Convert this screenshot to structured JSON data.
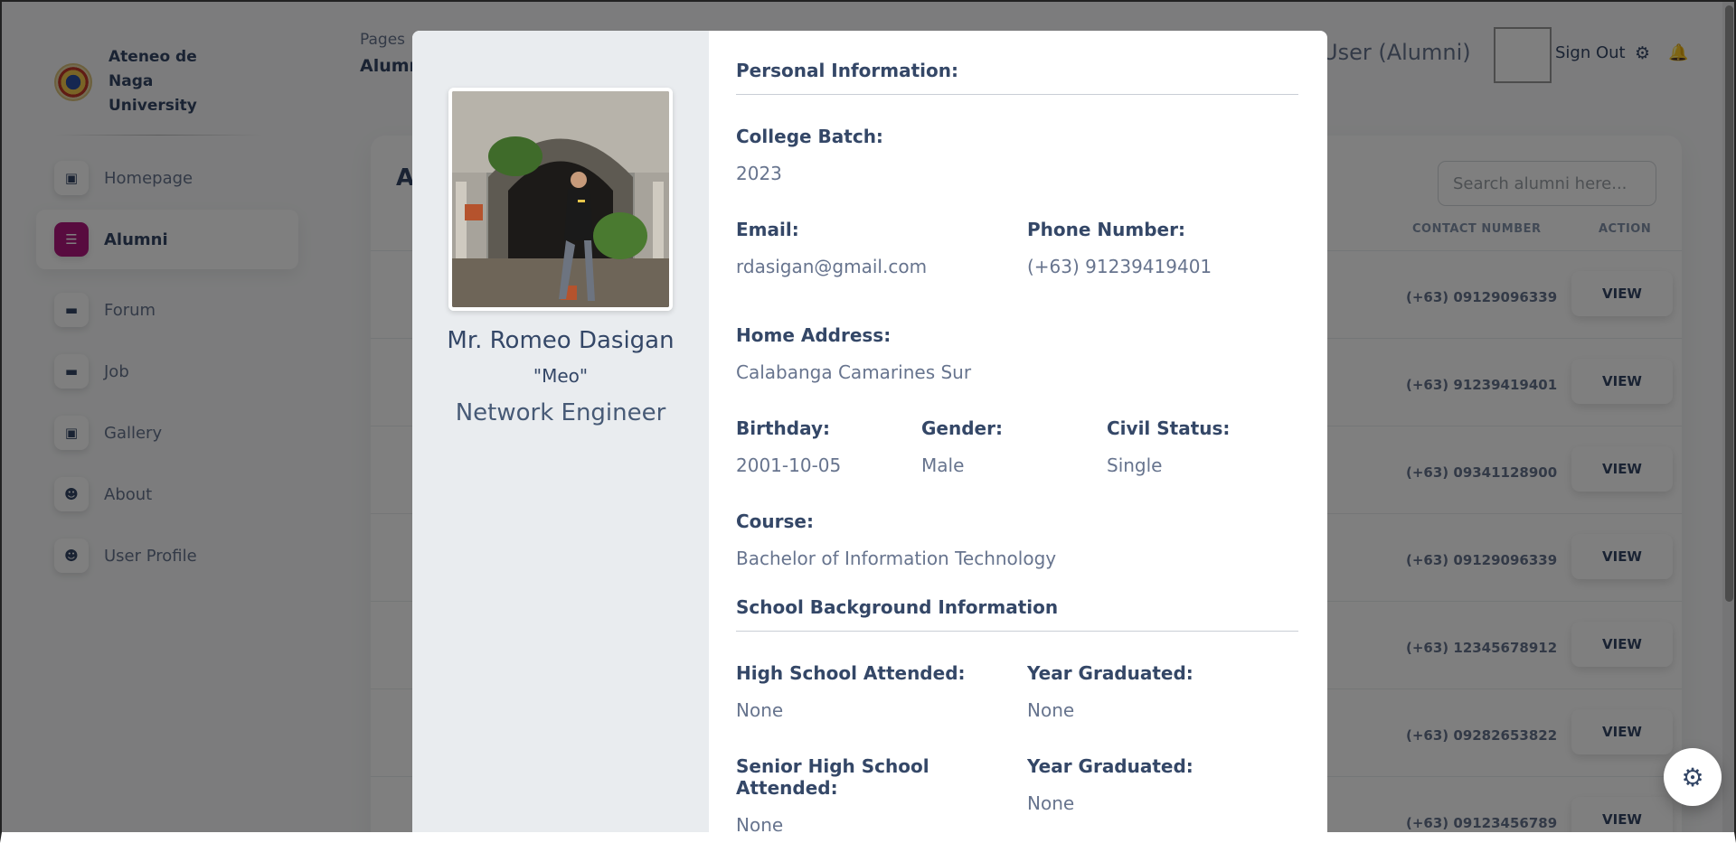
{
  "sidebar": {
    "brand": "Ateneo de Naga University",
    "items": [
      {
        "label": "Homepage",
        "icon": "document-icon"
      },
      {
        "label": "Alumni",
        "icon": "list-icon",
        "active": true
      },
      {
        "label": "Forum",
        "icon": "card-icon"
      },
      {
        "label": "Job",
        "icon": "card-icon"
      },
      {
        "label": "Gallery",
        "icon": "document-icon"
      },
      {
        "label": "About",
        "icon": "user-icon"
      },
      {
        "label": "User Profile",
        "icon": "user-icon"
      }
    ]
  },
  "topbar": {
    "breadcrumb": "Pages",
    "page_title": "Alumni",
    "user_label": "User (Alumni)",
    "sign_out": "Sign Out"
  },
  "card": {
    "title": "A",
    "search_placeholder": "Search alumni here...",
    "columns": {
      "contact": "CONTACT NUMBER",
      "action": "ACTION"
    },
    "rows": [
      {
        "contact": "(+63) 09129096339",
        "action": "VIEW"
      },
      {
        "contact": "(+63) 91239419401",
        "action": "VIEW"
      },
      {
        "contact": "(+63) 09341128900",
        "action": "VIEW"
      },
      {
        "contact": "(+63) 09129096339",
        "action": "VIEW"
      },
      {
        "contact": "(+63) 12345678912",
        "action": "VIEW"
      },
      {
        "contact": "(+63) 09282653822",
        "action": "VIEW"
      },
      {
        "contact": "(+63) 09123456789",
        "action": "VIEW"
      }
    ]
  },
  "modal": {
    "name": "Mr. Romeo Dasigan",
    "nickname": "\"Meo\"",
    "job": "Network Engineer",
    "personal": {
      "title": "Personal Information:",
      "batch_label": "College Batch:",
      "batch": "2023",
      "email_label": "Email:",
      "email": "rdasigan@gmail.com",
      "phone_label": "Phone Number:",
      "phone": "(+63) 91239419401",
      "address_label": "Home Address:",
      "address": "Calabanga Camarines Sur",
      "birthday_label": "Birthday:",
      "birthday": "2001-10-05",
      "gender_label": "Gender:",
      "gender": "Male",
      "civil_label": "Civil Status:",
      "civil": "Single",
      "course_label": "Course:",
      "course": "Bachelor of Information Technology"
    },
    "school": {
      "title": "School Background Information",
      "hs_label": "High School Attended:",
      "hs": "None",
      "hs_year_label": "Year Graduated:",
      "hs_year": "None",
      "shs_label": "Senior High School Attended:",
      "shs": "None",
      "shs_year_label": "Year Graduated:",
      "shs_year": "None"
    }
  },
  "colors": {
    "accent": "#b0167f",
    "text_dark": "#344767",
    "text_muted": "#67748e",
    "modal_left_bg": "#e9ecef"
  }
}
